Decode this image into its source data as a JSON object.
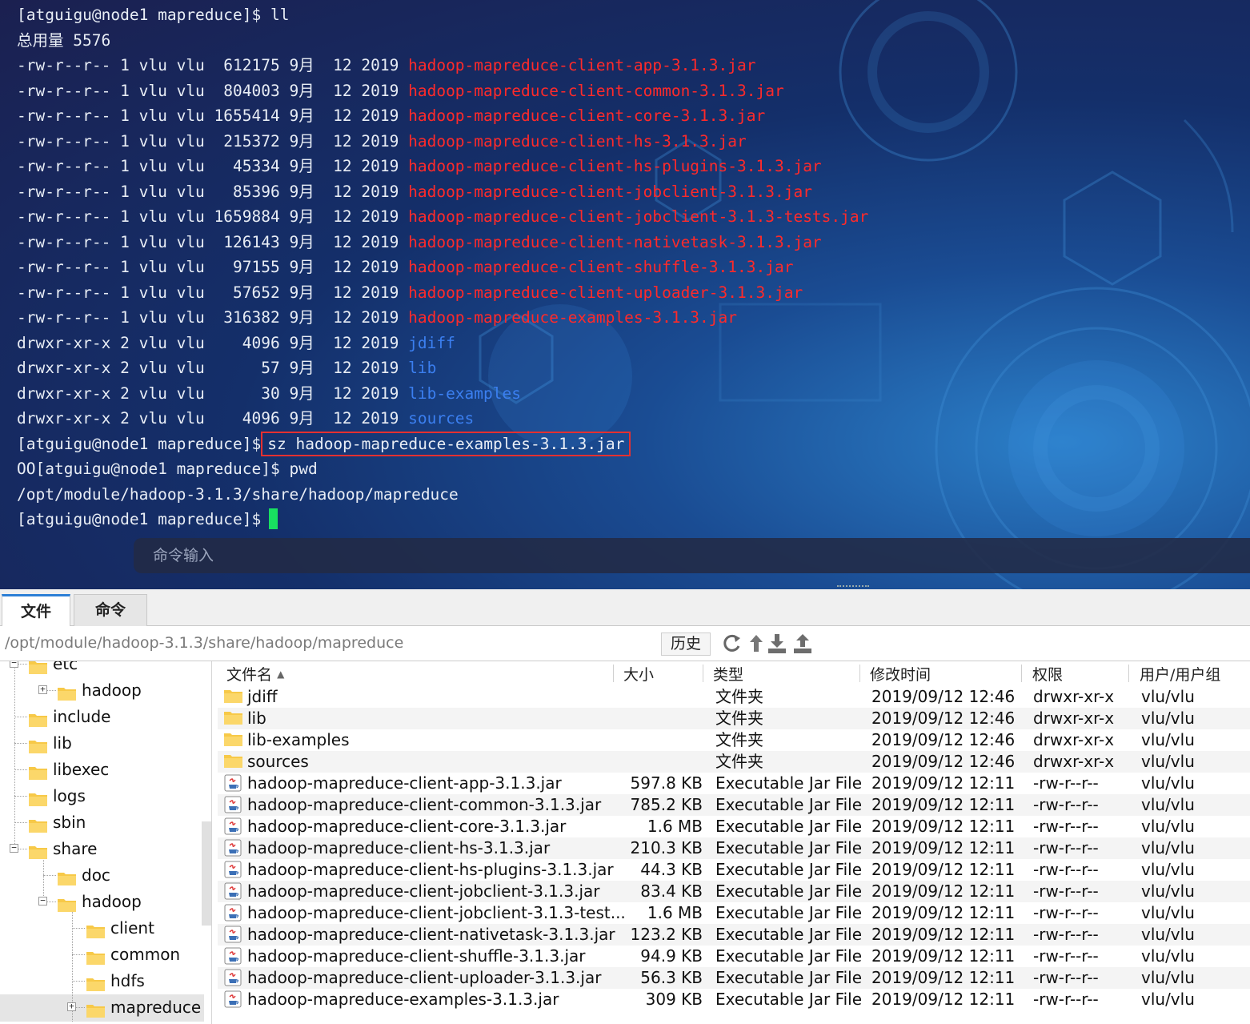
{
  "terminal": {
    "lines": [
      {
        "parts": [
          {
            "t": "[atguigu@node1 mapreduce]$ ll",
            "c": ""
          }
        ]
      },
      {
        "parts": [
          {
            "t": "总用量 5576",
            "c": ""
          }
        ]
      },
      {
        "parts": [
          {
            "t": "-rw-r--r-- 1 vlu vlu  612175 9月  12 2019 ",
            "c": ""
          },
          {
            "t": "hadoop-mapreduce-client-app-3.1.3.jar",
            "c": "f-red"
          }
        ]
      },
      {
        "parts": [
          {
            "t": "-rw-r--r-- 1 vlu vlu  804003 9月  12 2019 ",
            "c": ""
          },
          {
            "t": "hadoop-mapreduce-client-common-3.1.3.jar",
            "c": "f-red"
          }
        ]
      },
      {
        "parts": [
          {
            "t": "-rw-r--r-- 1 vlu vlu 1655414 9月  12 2019 ",
            "c": ""
          },
          {
            "t": "hadoop-mapreduce-client-core-3.1.3.jar",
            "c": "f-red"
          }
        ]
      },
      {
        "parts": [
          {
            "t": "-rw-r--r-- 1 vlu vlu  215372 9月  12 2019 ",
            "c": ""
          },
          {
            "t": "hadoop-mapreduce-client-hs-3.1.3.jar",
            "c": "f-red"
          }
        ]
      },
      {
        "parts": [
          {
            "t": "-rw-r--r-- 1 vlu vlu   45334 9月  12 2019 ",
            "c": ""
          },
          {
            "t": "hadoop-mapreduce-client-hs-plugins-3.1.3.jar",
            "c": "f-red"
          }
        ]
      },
      {
        "parts": [
          {
            "t": "-rw-r--r-- 1 vlu vlu   85396 9月  12 2019 ",
            "c": ""
          },
          {
            "t": "hadoop-mapreduce-client-jobclient-3.1.3.jar",
            "c": "f-red"
          }
        ]
      },
      {
        "parts": [
          {
            "t": "-rw-r--r-- 1 vlu vlu 1659884 9月  12 2019 ",
            "c": ""
          },
          {
            "t": "hadoop-mapreduce-client-jobclient-3.1.3-tests.jar",
            "c": "f-red"
          }
        ]
      },
      {
        "parts": [
          {
            "t": "-rw-r--r-- 1 vlu vlu  126143 9月  12 2019 ",
            "c": ""
          },
          {
            "t": "hadoop-mapreduce-client-nativetask-3.1.3.jar",
            "c": "f-red"
          }
        ]
      },
      {
        "parts": [
          {
            "t": "-rw-r--r-- 1 vlu vlu   97155 9月  12 2019 ",
            "c": ""
          },
          {
            "t": "hadoop-mapreduce-client-shuffle-3.1.3.jar",
            "c": "f-red"
          }
        ]
      },
      {
        "parts": [
          {
            "t": "-rw-r--r-- 1 vlu vlu   57652 9月  12 2019 ",
            "c": ""
          },
          {
            "t": "hadoop-mapreduce-client-uploader-3.1.3.jar",
            "c": "f-red"
          }
        ]
      },
      {
        "parts": [
          {
            "t": "-rw-r--r-- 1 vlu vlu  316382 9月  12 2019 ",
            "c": ""
          },
          {
            "t": "hadoop-mapreduce-examples-3.1.3.jar",
            "c": "f-red"
          }
        ]
      },
      {
        "parts": [
          {
            "t": "drwxr-xr-x 2 vlu vlu    4096 9月  12 2019 ",
            "c": ""
          },
          {
            "t": "jdiff",
            "c": "f-blue"
          }
        ]
      },
      {
        "parts": [
          {
            "t": "drwxr-xr-x 2 vlu vlu      57 9月  12 2019 ",
            "c": ""
          },
          {
            "t": "lib",
            "c": "f-blue"
          }
        ]
      },
      {
        "parts": [
          {
            "t": "drwxr-xr-x 2 vlu vlu      30 9月  12 2019 ",
            "c": ""
          },
          {
            "t": "lib-examples",
            "c": "f-blue"
          }
        ]
      },
      {
        "parts": [
          {
            "t": "drwxr-xr-x 2 vlu vlu    4096 9月  12 2019 ",
            "c": ""
          },
          {
            "t": "sources",
            "c": "f-blue"
          }
        ]
      },
      {
        "parts": [
          {
            "t": "[atguigu@node1 mapreduce]$",
            "c": ""
          },
          {
            "t": "sz hadoop-mapreduce-examples-3.1.3.jar",
            "c": "boxed"
          }
        ]
      },
      {
        "parts": [
          {
            "t": "OO[atguigu@node1 mapreduce]$ pwd",
            "c": ""
          }
        ]
      },
      {
        "parts": [
          {
            "t": "/opt/module/hadoop-3.1.3/share/hadoop/mapreduce",
            "c": ""
          }
        ]
      },
      {
        "parts": [
          {
            "t": "[atguigu@node1 mapreduce]$",
            "c": ""
          }
        ],
        "cursor": true
      }
    ],
    "command_input_placeholder": "命令输入"
  },
  "tabs": {
    "file": "文件",
    "command": "命令"
  },
  "pathbar": {
    "path": "/opt/module/hadoop-3.1.3/share/hadoop/mapreduce",
    "history_label": "历史",
    "tools": [
      "refresh-icon",
      "up-dir-icon",
      "download-icon",
      "upload-icon"
    ]
  },
  "tree": {
    "items": [
      {
        "label": "etc",
        "expander": "−"
      },
      {
        "label": "hadoop",
        "expander": "+"
      },
      {
        "label": "include",
        "expander": ""
      },
      {
        "label": "lib",
        "expander": ""
      },
      {
        "label": "libexec",
        "expander": ""
      },
      {
        "label": "logs",
        "expander": ""
      },
      {
        "label": "sbin",
        "expander": ""
      },
      {
        "label": "share",
        "expander": "−"
      },
      {
        "label": "doc",
        "expander": ""
      },
      {
        "label": "hadoop",
        "expander": "−"
      },
      {
        "label": "client",
        "expander": ""
      },
      {
        "label": "common",
        "expander": ""
      },
      {
        "label": "hdfs",
        "expander": ""
      },
      {
        "label": "mapreduce",
        "expander": "+",
        "selected": true
      }
    ]
  },
  "filelist": {
    "columns": {
      "name": "文件名",
      "size": "大小",
      "type": "类型",
      "modified": "修改时间",
      "permissions": "权限",
      "owner": "用户/用户组"
    },
    "rows": [
      {
        "name": "jdiff",
        "size": "",
        "type": "文件夹",
        "modified": "2019/09/12 12:46",
        "perm": "drwxr-xr-x",
        "owner": "vlu/vlu",
        "kind": "folder"
      },
      {
        "name": "lib",
        "size": "",
        "type": "文件夹",
        "modified": "2019/09/12 12:46",
        "perm": "drwxr-xr-x",
        "owner": "vlu/vlu",
        "kind": "folder"
      },
      {
        "name": "lib-examples",
        "size": "",
        "type": "文件夹",
        "modified": "2019/09/12 12:46",
        "perm": "drwxr-xr-x",
        "owner": "vlu/vlu",
        "kind": "folder"
      },
      {
        "name": "sources",
        "size": "",
        "type": "文件夹",
        "modified": "2019/09/12 12:46",
        "perm": "drwxr-xr-x",
        "owner": "vlu/vlu",
        "kind": "folder"
      },
      {
        "name": "hadoop-mapreduce-client-app-3.1.3.jar",
        "size": "597.8 KB",
        "type": "Executable Jar File",
        "modified": "2019/09/12 12:11",
        "perm": "-rw-r--r--",
        "owner": "vlu/vlu",
        "kind": "jar"
      },
      {
        "name": "hadoop-mapreduce-client-common-3.1.3.jar",
        "size": "785.2 KB",
        "type": "Executable Jar File",
        "modified": "2019/09/12 12:11",
        "perm": "-rw-r--r--",
        "owner": "vlu/vlu",
        "kind": "jar"
      },
      {
        "name": "hadoop-mapreduce-client-core-3.1.3.jar",
        "size": "1.6 MB",
        "type": "Executable Jar File",
        "modified": "2019/09/12 12:11",
        "perm": "-rw-r--r--",
        "owner": "vlu/vlu",
        "kind": "jar"
      },
      {
        "name": "hadoop-mapreduce-client-hs-3.1.3.jar",
        "size": "210.3 KB",
        "type": "Executable Jar File",
        "modified": "2019/09/12 12:11",
        "perm": "-rw-r--r--",
        "owner": "vlu/vlu",
        "kind": "jar"
      },
      {
        "name": "hadoop-mapreduce-client-hs-plugins-3.1.3.jar",
        "size": "44.3 KB",
        "type": "Executable Jar File",
        "modified": "2019/09/12 12:11",
        "perm": "-rw-r--r--",
        "owner": "vlu/vlu",
        "kind": "jar"
      },
      {
        "name": "hadoop-mapreduce-client-jobclient-3.1.3.jar",
        "size": "83.4 KB",
        "type": "Executable Jar File",
        "modified": "2019/09/12 12:11",
        "perm": "-rw-r--r--",
        "owner": "vlu/vlu",
        "kind": "jar"
      },
      {
        "name": "hadoop-mapreduce-client-jobclient-3.1.3-test...",
        "size": "1.6 MB",
        "type": "Executable Jar File",
        "modified": "2019/09/12 12:11",
        "perm": "-rw-r--r--",
        "owner": "vlu/vlu",
        "kind": "jar"
      },
      {
        "name": "hadoop-mapreduce-client-nativetask-3.1.3.jar",
        "size": "123.2 KB",
        "type": "Executable Jar File",
        "modified": "2019/09/12 12:11",
        "perm": "-rw-r--r--",
        "owner": "vlu/vlu",
        "kind": "jar"
      },
      {
        "name": "hadoop-mapreduce-client-shuffle-3.1.3.jar",
        "size": "94.9 KB",
        "type": "Executable Jar File",
        "modified": "2019/09/12 12:11",
        "perm": "-rw-r--r--",
        "owner": "vlu/vlu",
        "kind": "jar"
      },
      {
        "name": "hadoop-mapreduce-client-uploader-3.1.3.jar",
        "size": "56.3 KB",
        "type": "Executable Jar File",
        "modified": "2019/09/12 12:11",
        "perm": "-rw-r--r--",
        "owner": "vlu/vlu",
        "kind": "jar"
      },
      {
        "name": "hadoop-mapreduce-examples-3.1.3.jar",
        "size": "309 KB",
        "type": "Executable Jar File",
        "modified": "2019/09/12 12:11",
        "perm": "-rw-r--r--",
        "owner": "vlu/vlu",
        "kind": "jar"
      }
    ]
  },
  "colors": {
    "terminal_text": "#e8edf5",
    "jar_text": "#ff2a2a",
    "dir_text": "#3b7ff0",
    "cursor": "#18e060",
    "highlight_box": "#e53030",
    "tab_accent": "#2c7fd6",
    "folder": "#f7c948"
  }
}
